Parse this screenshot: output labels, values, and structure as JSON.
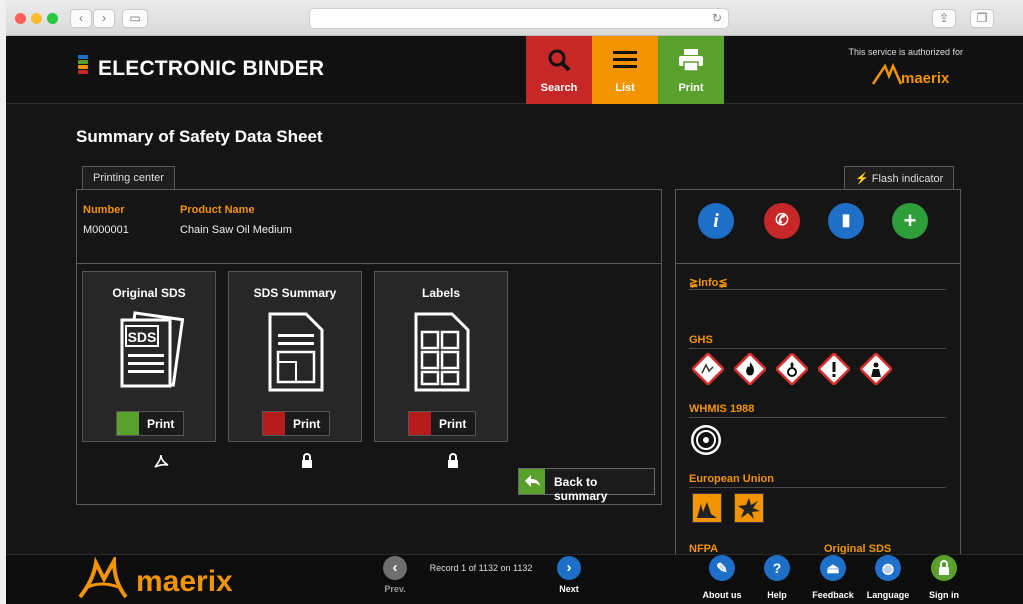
{
  "app": {
    "name": "ELECTRONIC BINDER",
    "authorized_text": "This service is authorized for",
    "brand_logo_text": "maerix"
  },
  "toolbar": {
    "search_label": "Search",
    "list_label": "List",
    "print_label": "Print"
  },
  "colors": {
    "search": "#c62828",
    "list": "#f29400",
    "print": "#5aa02c",
    "accent": "#f29400",
    "blue": "#1e6fc8"
  },
  "page": {
    "title": "Summary of Safety Data Sheet"
  },
  "printing_center": {
    "tab_label": "Printing center",
    "number_label": "Number",
    "number_value": "M000001",
    "product_label": "Product Name",
    "product_value": "Chain Saw Oil Medium",
    "cards": [
      {
        "title": "Original SDS",
        "icon": "sds-document-icon",
        "print_label": "Print",
        "print_icon": "pdf-icon"
      },
      {
        "title": "SDS Summary",
        "icon": "summary-document-icon",
        "print_label": "Print",
        "print_icon": "lock-icon"
      },
      {
        "title": "Labels",
        "icon": "labels-document-icon",
        "print_label": "Print",
        "print_icon": "lock-icon"
      }
    ],
    "back_label": "Back to summary"
  },
  "flash": {
    "tab_label": "Flash indicator",
    "icons": [
      "info-icon",
      "emergency-phone-icon",
      "extinguisher-icon",
      "first-aid-icon"
    ],
    "info_label": "Info",
    "ghs_label": "GHS",
    "ghs_pictograms": [
      "environment-icon",
      "flame-icon",
      "flame-over-circle-icon",
      "exclamation-icon",
      "health-hazard-icon"
    ],
    "whmis_label": "WHMIS 1988",
    "whmis_icons": [
      "biohazard-icon"
    ],
    "eu_label": "European Union",
    "eu_icons": [
      "dangerous-environment-icon",
      "explosive-icon"
    ],
    "nfpa_label": "NFPA",
    "original_sds_label": "Original SDS"
  },
  "footer": {
    "prev_label": "Prev.",
    "next_label": "Next",
    "record_text": "Record 1 of 1132 on 1132",
    "items": [
      {
        "label": "About us",
        "icon": "pen-icon"
      },
      {
        "label": "Help",
        "icon": "question-icon"
      },
      {
        "label": "Feedback",
        "icon": "bell-icon"
      },
      {
        "label": "Language",
        "icon": "globe-icon"
      },
      {
        "label": "Sign in",
        "icon": "lock-icon"
      }
    ]
  }
}
